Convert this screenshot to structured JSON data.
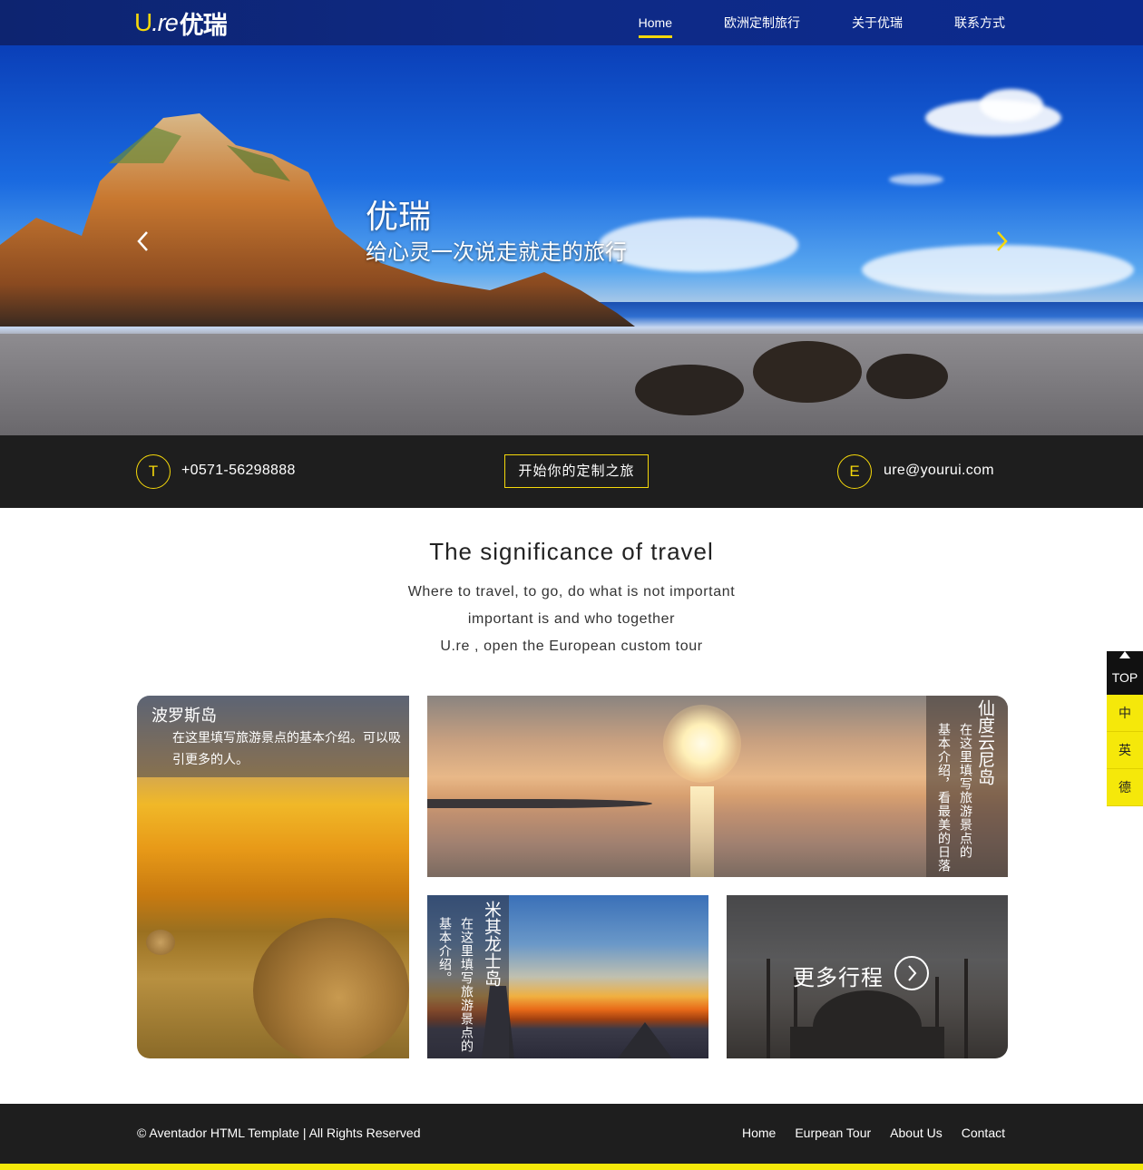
{
  "header": {
    "logo_u": "U",
    "logo_re": ".re",
    "logo_cn": "优瑞",
    "nav": [
      {
        "label": "Home",
        "active": true
      },
      {
        "label": "欧洲定制旅行"
      },
      {
        "label": "关于优瑞"
      },
      {
        "label": "联系方式"
      }
    ]
  },
  "hero": {
    "title": "优瑞",
    "subtitle": "给心灵一次说走就走的旅行"
  },
  "contact": {
    "phone_icon": "T",
    "phone": "+0571-56298888",
    "cta": "开始你的定制之旅",
    "email_icon": "E",
    "email": "ure@yourui.com"
  },
  "intro": {
    "title": "The significance of travel",
    "lines": [
      "Where to travel, to go, do what is not important",
      "important is and who together",
      "U.re , open the European custom tour"
    ]
  },
  "gallery": {
    "card1": {
      "title": "波罗斯岛",
      "desc": "在这里填写旅游景点的基本介绍。可以吸引更多的人。"
    },
    "card2": {
      "title": "仙度云尼岛",
      "desc1": "在这里填写旅游景点的",
      "desc2": "基本介绍，看最美的日落"
    },
    "card3": {
      "title": "米其龙士岛",
      "desc1": "在这里填写旅游景点的",
      "desc2": "基本介绍。"
    },
    "card4": {
      "more": "更多行程"
    }
  },
  "float": {
    "top": "TOP",
    "langs": [
      "中",
      "英",
      "德"
    ]
  },
  "footer": {
    "copyright": "© Aventador HTML Template  |  All Rights Reserved",
    "links": [
      "Home",
      "Eurpean Tour",
      "About Us",
      "Contact"
    ]
  },
  "colors": {
    "accent": "#f5d80a",
    "header": "#0e2a86",
    "dark": "#1e1e1e"
  }
}
